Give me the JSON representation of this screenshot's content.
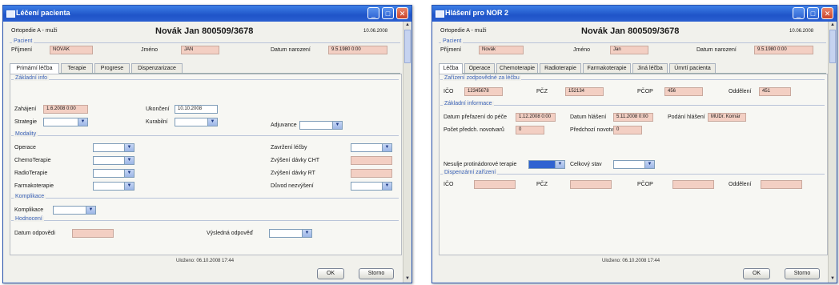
{
  "window1": {
    "title": "Léčení pacienta",
    "department": "Ortopedie A - muži",
    "patient_header": "Novák Jan 800509/3678",
    "date": "10.06.2008",
    "patient_group": {
      "title": "Pacient",
      "surname_label": "Příjmení",
      "surname_value": "NOVÁK",
      "firstname_label": "Jméno",
      "firstname_value": "JAN",
      "birth_label": "Datum narození",
      "birth_value": "9.5.1980 0:00"
    },
    "tabs": [
      "Primární léčba",
      "Terapie",
      "Progrese",
      "Dispenzarizace"
    ],
    "basic_info": {
      "title": "Základní info",
      "start_label": "Zahájení",
      "start_value": "1.6.2008 0:00",
      "end_label": "Ukončení",
      "end_value": "10.10.2008",
      "strategy_label": "Strategie",
      "curability_label": "Kurabilní",
      "adjuvance_label": "Adjuvance"
    },
    "modality": {
      "title": "Modality",
      "items": [
        "Operace",
        "ChemoTerapie",
        "RadioTerapie",
        "Farmakoterapie"
      ],
      "right_items": [
        "Zavržení léčby",
        "Zvýšení dávky CHT",
        "Zvýšení dávky RT",
        "Důvod nezvýšení"
      ]
    },
    "complications": {
      "title": "Komplikace",
      "label": "Komplikace"
    },
    "evaluation": {
      "title": "Hodnocení",
      "date_label": "Datum odpovědi",
      "result_label": "Výsledná odpověď"
    },
    "status": "Uloženo: 06.10.2008 17:44",
    "ok_label": "OK",
    "cancel_label": "Storno"
  },
  "window2": {
    "title": "Hlášení pro NOR 2",
    "department": "Ortopedie A - muži",
    "patient_header": "Novák Jan 800509/3678",
    "date": "10.06.2008",
    "patient_group": {
      "title": "Pacient",
      "surname_label": "Příjmení",
      "surname_value": "Novák",
      "firstname_label": "Jméno",
      "firstname_value": "Jan",
      "birth_label": "Datum narození",
      "birth_value": "9.5.1980 0:00"
    },
    "tabs": [
      "Léčba",
      "Operace",
      "Chemoterapie",
      "Radioterapie",
      "Farmakoterapie",
      "Jiná léčba",
      "Úmrtí pacienta"
    ],
    "treating_facility": {
      "title": "Zařízení zodpovědné za léčbu",
      "ico_label": "IČO",
      "ico_value": "12345678",
      "pcz_label": "PČZ",
      "pcz_value": "152134",
      "pcop_label": "PČOP",
      "pcop_value": "456",
      "branch_label": "Oddělení",
      "branch_value": "451"
    },
    "basic_information": {
      "title": "Základní informace",
      "inclusion_label": "Datum přeřazení do péče",
      "inclusion_value": "1.12.2008 0:00",
      "report_label": "Datum hlášení",
      "report_value": "5.11.2008 0:00",
      "place_label": "Podání hlášení",
      "place_value": "MUDr. Kornár",
      "count_label": "Počet předch. novotvarů",
      "count_value": "0",
      "prev_label": "Předchozí novotvary",
      "prev_value": "0"
    },
    "followup": {
      "label": "Nesulje protinádorové terapie",
      "status_label": "Celkový stav"
    },
    "disp_facility": {
      "title": "Dispenzární zařízení",
      "ico_label": "IČO",
      "pcz_label": "PČZ",
      "pcop_label": "PČOP",
      "branch_label": "Oddělení"
    },
    "status": "Uloženo: 06.10.2008 17:44",
    "ok_label": "OK",
    "cancel_label": "Storno"
  }
}
